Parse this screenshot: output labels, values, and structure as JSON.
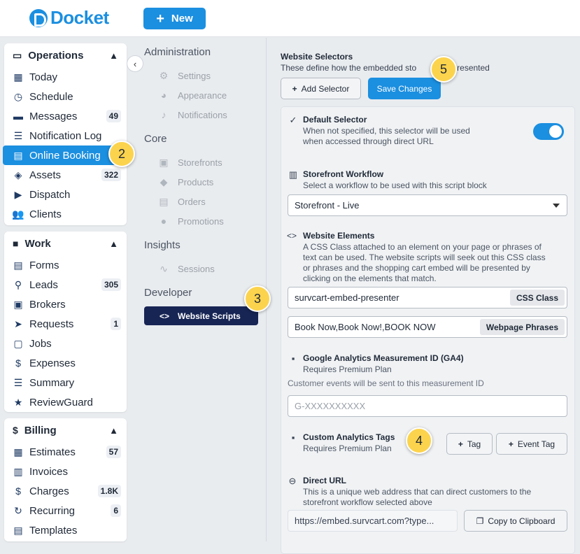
{
  "header": {
    "logo_text": "Docket",
    "new_label": "New"
  },
  "sidebar": {
    "operations": {
      "title": "Operations",
      "items": [
        {
          "label": "Today",
          "icon": "calendar-icon"
        },
        {
          "label": "Schedule",
          "icon": "clock-icon"
        },
        {
          "label": "Messages",
          "icon": "chat-icon",
          "badge": "49"
        },
        {
          "label": "Notification Log",
          "icon": "list-icon"
        },
        {
          "label": "Online Booking",
          "icon": "store-icon",
          "active": true
        },
        {
          "label": "Assets",
          "icon": "layers-icon",
          "badge": "322"
        },
        {
          "label": "Dispatch",
          "icon": "truck-icon"
        },
        {
          "label": "Clients",
          "icon": "users-icon"
        }
      ]
    },
    "work": {
      "title": "Work",
      "items": [
        {
          "label": "Forms",
          "icon": "form-icon"
        },
        {
          "label": "Leads",
          "icon": "lead-icon",
          "badge": "305"
        },
        {
          "label": "Brokers",
          "icon": "briefcase-icon"
        },
        {
          "label": "Requests",
          "icon": "send-icon",
          "badge": "1"
        },
        {
          "label": "Jobs",
          "icon": "jobs-icon"
        },
        {
          "label": "Expenses",
          "icon": "dollar-circle-icon"
        },
        {
          "label": "Summary",
          "icon": "summary-icon"
        },
        {
          "label": "ReviewGuard",
          "icon": "star-icon"
        }
      ]
    },
    "billing": {
      "title": "Billing",
      "items": [
        {
          "label": "Estimates",
          "icon": "calculator-icon",
          "badge": "57"
        },
        {
          "label": "Invoices",
          "icon": "invoice-icon"
        },
        {
          "label": "Charges",
          "icon": "dollar-icon",
          "badge": "1.8K"
        },
        {
          "label": "Recurring",
          "icon": "recurring-icon",
          "badge": "6"
        },
        {
          "label": "Templates",
          "icon": "template-icon"
        }
      ]
    }
  },
  "subnav": {
    "administration": {
      "title": "Administration",
      "items": [
        "Settings",
        "Appearance",
        "Notifications"
      ]
    },
    "core": {
      "title": "Core",
      "items": [
        "Storefronts",
        "Products",
        "Orders",
        "Promotions"
      ]
    },
    "insights": {
      "title": "Insights",
      "items": [
        "Sessions"
      ]
    },
    "developer": {
      "title": "Developer",
      "active_item": "Website Scripts"
    }
  },
  "main": {
    "title": "Website Selectors",
    "desc": "These define how the embedded sto",
    "desc_tail": "s presented",
    "add_selector": "Add Selector",
    "save_changes": "Save Changes",
    "default_selector": {
      "title": "Default Selector",
      "desc1": "When not specified, this selector will be used",
      "desc2": "when accessed through direct URL",
      "enabled": true
    },
    "workflow": {
      "title": "Storefront Workflow",
      "desc": "Select a workflow to be used with this script block",
      "value": "Storefront - Live"
    },
    "elements": {
      "title": "Website Elements",
      "desc1": "A CSS Class attached to an element on your page or phrases of",
      "desc2": "text can be used. The website scripts will seek out this CSS class",
      "desc3": "or phrases and the shopping cart embed will be presented by",
      "desc4": "clicking on the elements that match.",
      "css_value": "survcart-embed-presenter",
      "css_label": "CSS Class",
      "phrases_value": "Book Now,Book Now!,BOOK NOW",
      "phrases_label": "Webpage Phrases"
    },
    "ga": {
      "title": "Google Analytics Measurement ID (GA4)",
      "desc": "Requires Premium Plan",
      "note": "Customer events will be sent to this measurement ID",
      "placeholder": "G-XXXXXXXXXX"
    },
    "custom_tags": {
      "title": "Custom Analytics Tags",
      "desc": "Requires Premium Plan",
      "tag_label": "Tag",
      "event_tag_label": "Event Tag"
    },
    "direct_url": {
      "title": "Direct URL",
      "desc1": "This is a unique web address that can direct customers to the",
      "desc2": "storefront workflow selected above",
      "value": "https://embed.survcart.com?type...",
      "copy_label": "Copy to Clipboard"
    }
  },
  "steps": [
    "2",
    "3",
    "4",
    "5"
  ],
  "colors": {
    "accent": "#1b8fe0",
    "dark_nav": "#172554",
    "step_badge": "#fcd34d"
  }
}
